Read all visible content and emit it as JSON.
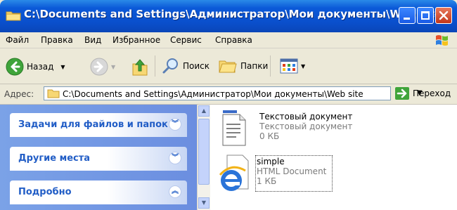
{
  "window": {
    "title": "C:\\Documents and Settings\\Администратор\\Мои документы\\Web site"
  },
  "menu": [
    "Файл",
    "Правка",
    "Вид",
    "Избранное",
    "Сервис",
    "Справка"
  ],
  "toolbar": {
    "back_label": "Назад",
    "search_label": "Поиск",
    "folders_label": "Папки"
  },
  "address": {
    "label": "Адрес:",
    "path": "C:\\Documents and Settings\\Администратор\\Мои документы\\Web site",
    "go_label": "Переход"
  },
  "taskpane": {
    "panels": [
      {
        "title": "Задачи для файлов и папок",
        "state": "collapsed"
      },
      {
        "title": "Другие места",
        "state": "collapsed"
      },
      {
        "title": "Подробно",
        "state": "expanded"
      }
    ]
  },
  "files": [
    {
      "name": "Текстовый документ",
      "type": "Текстовый документ",
      "size": "0 КБ",
      "icon": "text-document-icon",
      "selected": false
    },
    {
      "name": "simple",
      "type": "HTML Document",
      "size": "1 КБ",
      "icon": "internet-explorer-icon",
      "selected": true
    }
  ],
  "colors": {
    "titlebar": "#0a4fcc",
    "taskpane": "#7ba2e7",
    "panel_title": "#215dc6",
    "close_button": "#c2361b"
  }
}
